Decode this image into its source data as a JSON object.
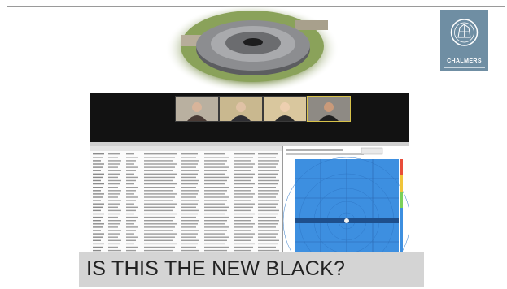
{
  "slide": {
    "caption": "IS THIS THE NEW BLACK?",
    "logo": {
      "name": "CHALMERS",
      "color": "#6f8ea3"
    }
  },
  "meeting": {
    "participants": 4,
    "active_tile": 4
  },
  "colors": {
    "caption_band": "#d4d4d4",
    "video_bar": "#121212",
    "detector_blue": "#4aa3f0"
  }
}
